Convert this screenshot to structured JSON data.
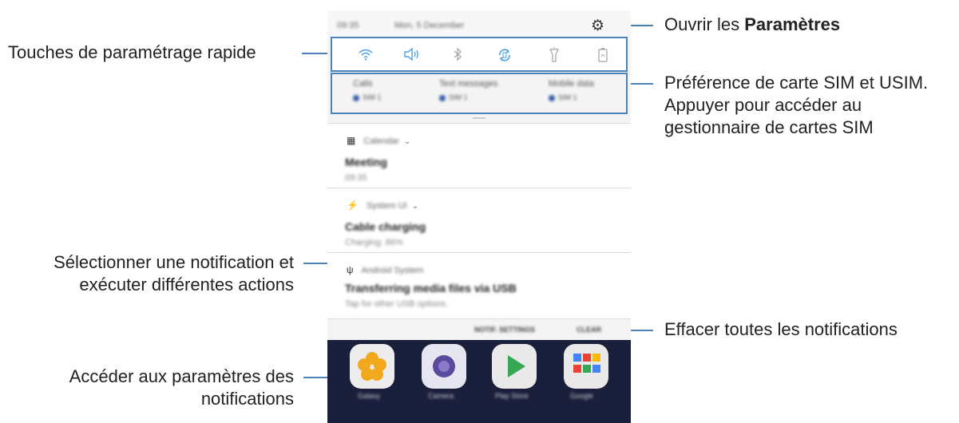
{
  "callouts": {
    "quick_settings": "Touches de paramétrage rapide",
    "settings_prefix": "Ouvrir les ",
    "settings_bold": "Paramètres",
    "sim_line1": "Préférence de carte SIM et USIM.",
    "sim_line2": "Appuyer pour accéder au",
    "sim_line3": "gestionnaire de cartes SIM",
    "notif_line1": "Sélectionner une notification et",
    "notif_line2": "exécuter différentes actions",
    "clear_all": "Effacer toutes les notifications",
    "notif_settings_line1": "Accéder aux paramètres des",
    "notif_settings_line2": "notifications"
  },
  "phone": {
    "status_time": "09:35",
    "status_date": "Mon, 5 December",
    "quick_settings": [
      {
        "icon": "wifi-icon",
        "active": true
      },
      {
        "icon": "sound-icon",
        "active": true
      },
      {
        "icon": "bluetooth-icon",
        "active": false
      },
      {
        "icon": "auto-rotate-icon",
        "active": true
      },
      {
        "icon": "flashlight-icon",
        "active": false
      },
      {
        "icon": "power-saving-icon",
        "active": false
      }
    ],
    "sim": [
      {
        "label": "Calls",
        "value": "SIM 1"
      },
      {
        "label": "Text messages",
        "value": "SIM 1"
      },
      {
        "label": "Mobile data",
        "value": "SIM 1"
      }
    ],
    "notifications": [
      {
        "app": "Calendar",
        "title": "Meeting",
        "sub": "09:35"
      },
      {
        "app": "System UI",
        "title": "Cable charging",
        "sub": "Charging: 86%"
      },
      {
        "app": "Android System",
        "title": "Transferring media files via USB",
        "sub": "Tap for other USB options."
      }
    ],
    "actions": {
      "notif_settings": "NOTIF. SETTINGS",
      "clear": "CLEAR"
    },
    "home_apps": [
      "Galaxy",
      "Camera",
      "Play Store",
      "Google"
    ]
  },
  "colors": {
    "accent": "#4d82b8",
    "qs_active": "#4d9fe0"
  }
}
